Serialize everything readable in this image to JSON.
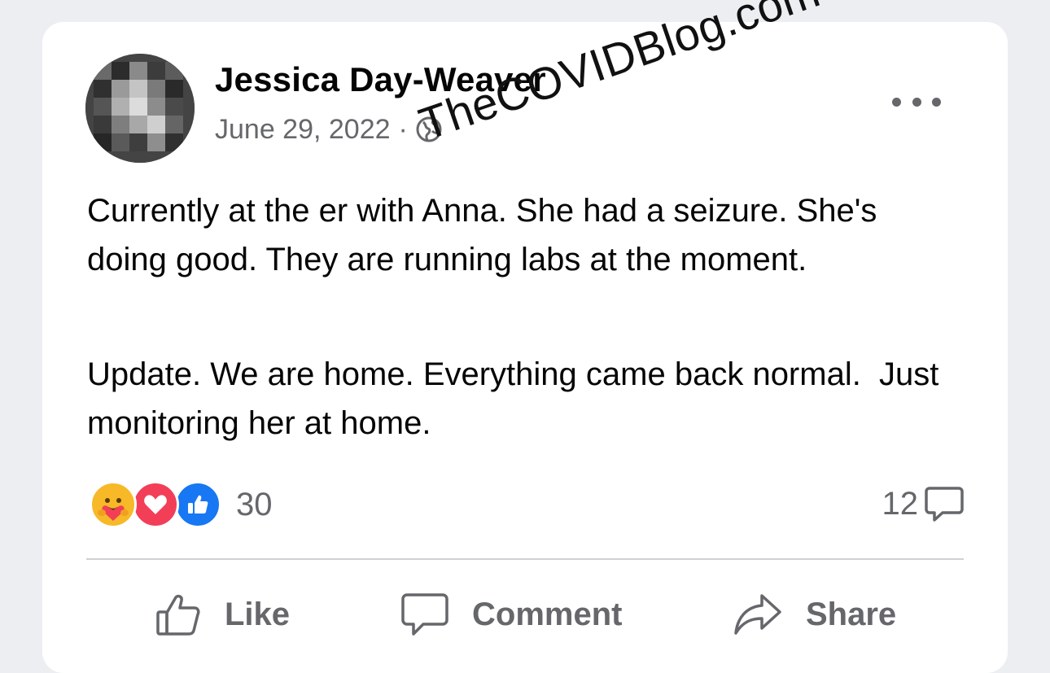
{
  "post": {
    "author": "Jessica Day-Weaver",
    "date": "June 29, 2022",
    "separator": "·",
    "visibility_icon": "globe-icon",
    "body": [
      "Currently at the er with Anna. She had a seizure. She's doing good. They are running labs at the moment.",
      "Update. We are home. Everything came back normal.  Just monitoring her at home."
    ]
  },
  "watermark": "TheCOVIDBlog.com",
  "reactions": {
    "icons": [
      "care-reaction-icon",
      "love-reaction-icon",
      "like-reaction-icon"
    ],
    "count": "30",
    "comments_count": "12"
  },
  "actions": {
    "like": "Like",
    "comment": "Comment",
    "share": "Share"
  },
  "colors": {
    "text": "#050505",
    "secondary": "#65676b",
    "like_blue": "#1877f2",
    "love_red": "#f33e58",
    "care_yellow": "#f7b928"
  }
}
